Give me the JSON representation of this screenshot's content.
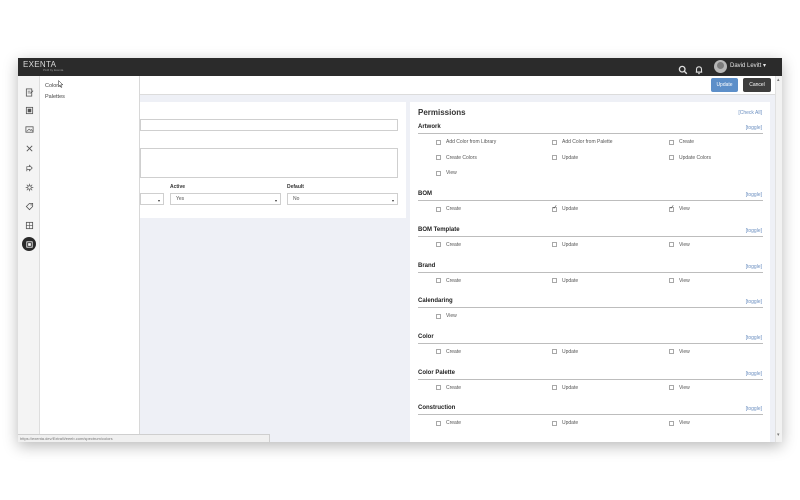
{
  "app": {
    "logo": "EXENTA",
    "logo_sub": "PLM by Exenta",
    "user_name": "David Levitt ▾"
  },
  "actions": {
    "update_label": "Update",
    "cancel_label": "Cancel"
  },
  "flyout": {
    "items": [
      "Colors",
      "Palettes"
    ]
  },
  "form": {
    "active_label": "Active",
    "active_value": "Yes",
    "default_label": "Default",
    "default_value": "No"
  },
  "permissions": {
    "title": "Permissions",
    "check_all": "[Check All]",
    "toggle_label": "[toggle]",
    "groups": [
      {
        "name": "Artwork",
        "items": [
          {
            "label": "Add Color from Library",
            "checked": false
          },
          {
            "label": "Add Color from Palette",
            "checked": false
          },
          {
            "label": "Create",
            "checked": false
          },
          {
            "label": "Create Colors",
            "checked": false
          },
          {
            "label": "Update",
            "checked": false
          },
          {
            "label": "Update Colors",
            "checked": false
          },
          {
            "label": "View",
            "checked": false
          }
        ]
      },
      {
        "name": "BOM",
        "items": [
          {
            "label": "Create",
            "checked": false
          },
          {
            "label": "Update",
            "checked": true
          },
          {
            "label": "View",
            "checked": true
          }
        ]
      },
      {
        "name": "BOM Template",
        "items": [
          {
            "label": "Create",
            "checked": false
          },
          {
            "label": "Update",
            "checked": false
          },
          {
            "label": "View",
            "checked": false
          }
        ]
      },
      {
        "name": "Brand",
        "items": [
          {
            "label": "Create",
            "checked": false
          },
          {
            "label": "Update",
            "checked": false
          },
          {
            "label": "View",
            "checked": false
          }
        ]
      },
      {
        "name": "Calendaring",
        "items": [
          {
            "label": "View",
            "checked": false
          }
        ]
      },
      {
        "name": "Color",
        "items": [
          {
            "label": "Create",
            "checked": false
          },
          {
            "label": "Update",
            "checked": false
          },
          {
            "label": "View",
            "checked": false
          }
        ]
      },
      {
        "name": "Color Palette",
        "items": [
          {
            "label": "Create",
            "checked": false
          },
          {
            "label": "Update",
            "checked": false
          },
          {
            "label": "View",
            "checked": false
          }
        ]
      },
      {
        "name": "Construction",
        "items": [
          {
            "label": "Create",
            "checked": false
          },
          {
            "label": "Update",
            "checked": false
          },
          {
            "label": "View",
            "checked": false
          }
        ]
      }
    ]
  },
  "status_url": "https://exenta.dev/ExtraWeeeb.com/spectrum/colors",
  "colors": {
    "accent": "#5d8fc9",
    "topbar": "#2b2b2b",
    "link": "#6b8fc0"
  }
}
